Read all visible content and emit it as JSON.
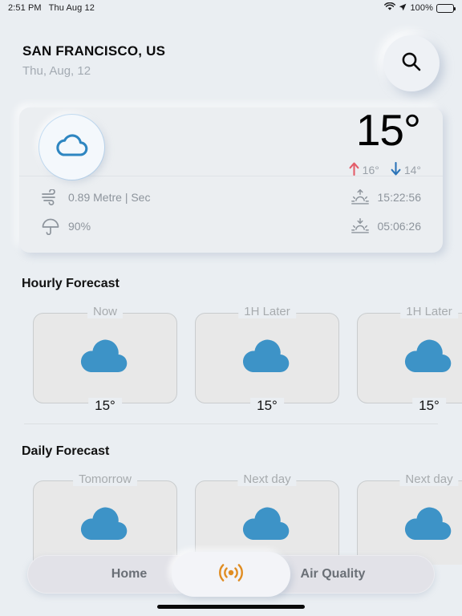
{
  "status_bar": {
    "time": "2:51 PM",
    "date": "Thu Aug 12",
    "battery_percent": "100%",
    "wifi_icon": "wifi-icon",
    "location_icon": "location-arrow-icon",
    "battery_icon": "battery-full-icon"
  },
  "header": {
    "city": "SAN FRANCISCO, US",
    "date": "Thu, Aug, 12",
    "search_icon": "search-icon"
  },
  "current": {
    "condition_icon": "cloud-outline-icon",
    "temperature": "15°",
    "high_temp": "16°",
    "low_temp": "14°",
    "high_icon": "arrow-up-icon",
    "low_icon": "arrow-down-icon",
    "wind": "0.89 Metre | Sec",
    "wind_icon": "wind-icon",
    "precipitation": "90%",
    "precipitation_icon": "umbrella-icon",
    "sunrise": "15:22:56",
    "sunrise_icon": "sunrise-icon",
    "sunset": "05:06:26",
    "sunset_icon": "sunset-icon"
  },
  "hourly": {
    "title": "Hourly Forecast",
    "items": [
      {
        "label": "Now",
        "icon": "cloud-filled-icon",
        "temp": "15°"
      },
      {
        "label": "1H Later",
        "icon": "cloud-filled-icon",
        "temp": "15°"
      },
      {
        "label": "1H Later",
        "icon": "cloud-filled-icon",
        "temp": "15°"
      }
    ]
  },
  "daily": {
    "title": "Daily Forecast",
    "items": [
      {
        "label": "Tomorrow",
        "icon": "cloud-filled-icon"
      },
      {
        "label": "Next day",
        "icon": "cloud-filled-icon"
      },
      {
        "label": "Next day",
        "icon": "cloud-filled-icon"
      }
    ]
  },
  "nav": {
    "home_label": "Home",
    "air_quality_label": "Air Quality",
    "center_icon": "broadcast-icon"
  },
  "colors": {
    "background": "#eaeef2",
    "cloud_blue": "#3d93c7",
    "accent_orange": "#e08c21",
    "high_red": "#e35d6a",
    "low_blue": "#2b74b8",
    "muted_text": "#9aa1a9"
  }
}
